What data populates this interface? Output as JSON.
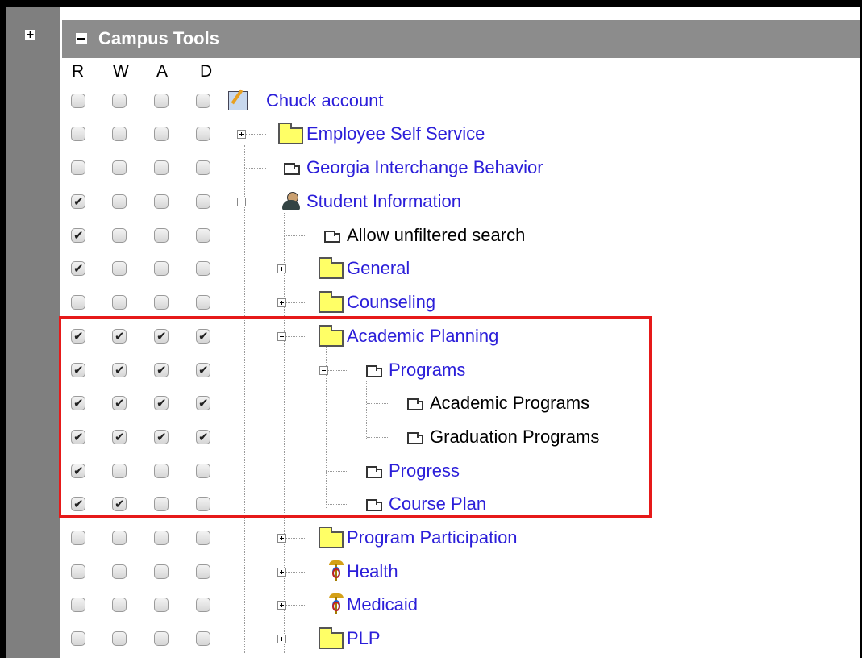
{
  "panel": {
    "title": "Campus Tools"
  },
  "columns": [
    "R",
    "W",
    "A",
    "D"
  ],
  "rows": [
    {
      "label": "Chuck account",
      "link": true,
      "icon": "account-icon",
      "checks": [
        false,
        false,
        false,
        false
      ]
    },
    {
      "label": "Employee Self Service",
      "link": true,
      "icon": "folder-icon",
      "toggle": "plus",
      "checks": [
        false,
        false,
        false,
        false
      ]
    },
    {
      "label": "Georgia Interchange Behavior",
      "link": true,
      "icon": "page-icon",
      "checks": [
        false,
        false,
        false,
        false
      ]
    },
    {
      "label": "Student Information",
      "link": true,
      "icon": "person-icon",
      "toggle": "minus",
      "checks": [
        true,
        false,
        false,
        false
      ]
    },
    {
      "label": "Allow unfiltered search",
      "link": false,
      "icon": "page-icon",
      "checks": [
        true,
        false,
        false,
        false
      ]
    },
    {
      "label": "General",
      "link": true,
      "icon": "folder-icon",
      "toggle": "plus",
      "checks": [
        true,
        false,
        false,
        false
      ]
    },
    {
      "label": "Counseling",
      "link": true,
      "icon": "folder-icon",
      "toggle": "plus",
      "checks": [
        false,
        false,
        false,
        false
      ]
    },
    {
      "label": "Academic Planning",
      "link": true,
      "icon": "folder-icon",
      "toggle": "minus",
      "checks": [
        true,
        true,
        true,
        true
      ]
    },
    {
      "label": "Programs",
      "link": true,
      "icon": "page-icon",
      "toggle": "minus",
      "checks": [
        true,
        true,
        true,
        true
      ]
    },
    {
      "label": "Academic Programs",
      "link": false,
      "icon": "page-icon",
      "checks": [
        true,
        true,
        true,
        true
      ]
    },
    {
      "label": "Graduation Programs",
      "link": false,
      "icon": "page-icon",
      "checks": [
        true,
        true,
        true,
        true
      ]
    },
    {
      "label": "Progress",
      "link": true,
      "icon": "page-icon",
      "checks": [
        true,
        false,
        false,
        false
      ]
    },
    {
      "label": "Course Plan",
      "link": true,
      "icon": "page-icon",
      "checks": [
        true,
        true,
        false,
        false
      ]
    },
    {
      "label": "Program Participation",
      "link": true,
      "icon": "folder-icon",
      "toggle": "plus",
      "checks": [
        false,
        false,
        false,
        false
      ]
    },
    {
      "label": "Health",
      "link": true,
      "icon": "caduceus-icon",
      "toggle": "plus",
      "checks": [
        false,
        false,
        false,
        false
      ]
    },
    {
      "label": "Medicaid",
      "link": true,
      "icon": "caduceus-icon",
      "toggle": "plus",
      "checks": [
        false,
        false,
        false,
        false
      ]
    },
    {
      "label": "PLP",
      "link": true,
      "icon": "folder-icon",
      "toggle": "plus",
      "checks": [
        false,
        false,
        false,
        false
      ]
    }
  ]
}
